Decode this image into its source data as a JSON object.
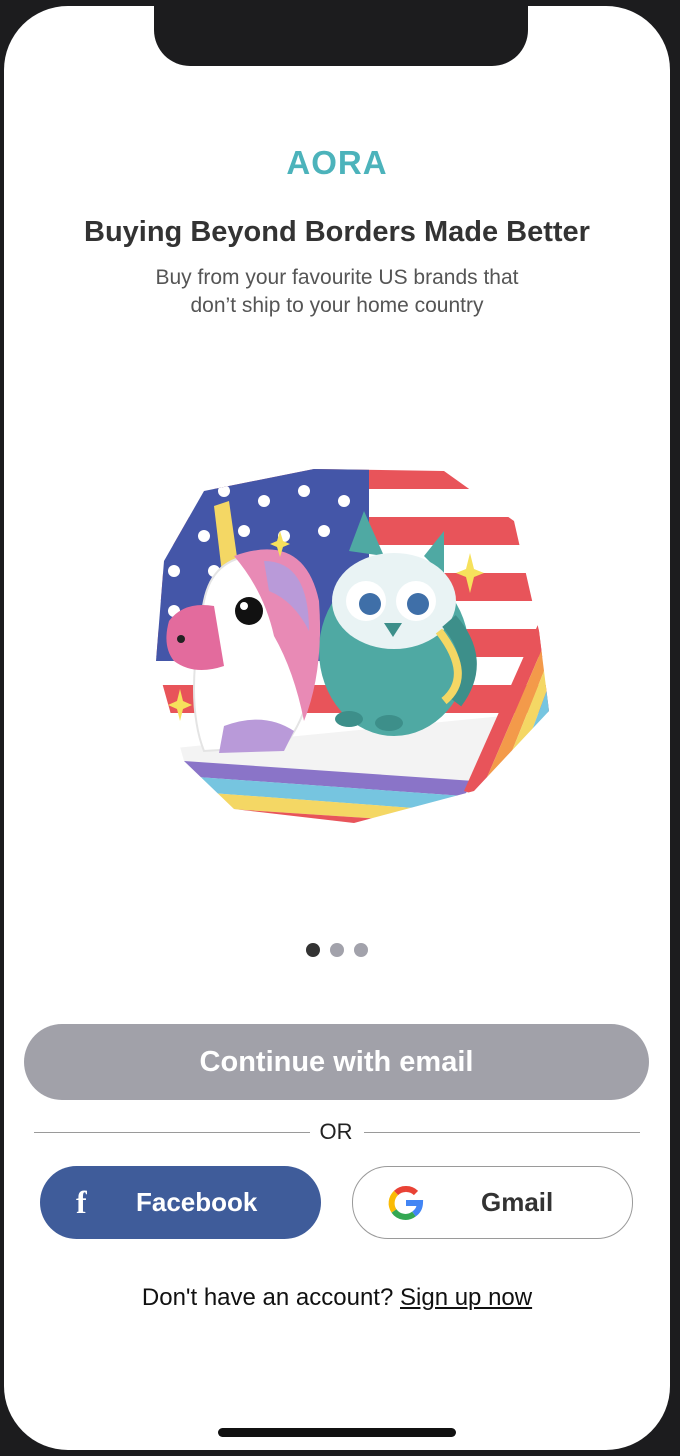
{
  "brand": {
    "name": "AORA",
    "color": "#4cb3bb"
  },
  "onboarding": {
    "headline": "Buying Beyond Borders Made Better",
    "subtitle": "Buy from your favourite US brands that don’t ship to your home country",
    "illustration": "unicorn-and-owl-on-us-flag-illustration",
    "carousel": {
      "total_pages": 3,
      "current_page": 1
    }
  },
  "auth": {
    "email_button": "Continue with email",
    "divider_text": "OR",
    "facebook": {
      "label": "Facebook",
      "icon": "facebook-icon",
      "color": "#3f5c9a"
    },
    "google": {
      "label": "Gmail",
      "icon": "google-icon"
    },
    "signup_prompt": "Don't have an account?",
    "signup_link": "Sign up now"
  },
  "colors": {
    "email_button_bg": "#a1a1a9",
    "active_dot": "#333333",
    "inactive_dot": "#a2a2ab"
  }
}
